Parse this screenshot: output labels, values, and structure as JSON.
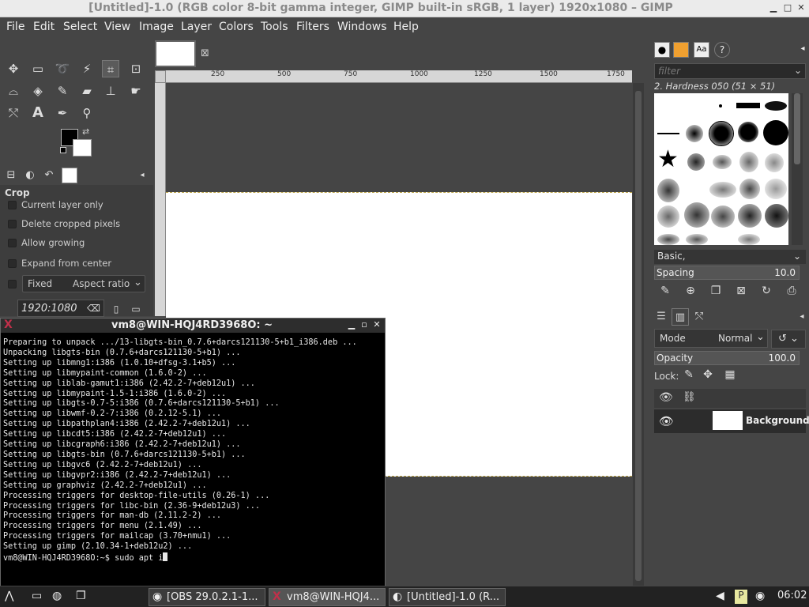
{
  "window": {
    "title": "[Untitled]-1.0 (RGB color 8-bit gamma integer, GIMP built-in sRGB, 1 layer) 1920x1080 – GIMP"
  },
  "menubar": [
    "File",
    "Edit",
    "Select",
    "View",
    "Image",
    "Layer",
    "Colors",
    "Tools",
    "Filters",
    "Windows",
    "Help"
  ],
  "tool_options": {
    "title": "Crop",
    "options": [
      "Current layer only",
      "Delete cropped pixels",
      "Allow growing",
      "Expand from center"
    ],
    "fixed_label": "Fixed",
    "fixed_mode": "Aspect ratio",
    "ratio_value": "1920:1080"
  },
  "ruler": {
    "h_ticks": [
      "250",
      "500",
      "750",
      "1000",
      "1250",
      "1500",
      "1750"
    ]
  },
  "brushes": {
    "filter_placeholder": "filter",
    "selected_name": "2. Hardness 050 (51 × 51)",
    "preset": "Basic,",
    "spacing_label": "Spacing",
    "spacing_value": "10.0"
  },
  "layers": {
    "mode_label": "Mode",
    "mode_value": "Normal",
    "opacity_label": "Opacity",
    "opacity_value": "100.0",
    "lock_label": "Lock:",
    "items": [
      {
        "name": "Background"
      }
    ]
  },
  "terminal": {
    "title": "vm8@WIN-HQJ4RD3968O: ~",
    "lines": [
      "Preparing to unpack .../13-libgts-bin_0.7.6+darcs121130-5+b1_i386.deb ...",
      "Unpacking libgts-bin (0.7.6+darcs121130-5+b1) ...",
      "Setting up libmng1:i386 (1.0.10+dfsg-3.1+b5) ...",
      "Setting up libmypaint-common (1.6.0-2) ...",
      "Setting up liblab-gamut1:i386 (2.42.2-7+deb12u1) ...",
      "Setting up libmypaint-1.5-1:i386 (1.6.0-2) ...",
      "Setting up libgts-0.7-5:i386 (0.7.6+darcs121130-5+b1) ...",
      "Setting up libwmf-0.2-7:i386 (0.2.12-5.1) ...",
      "Setting up libpathplan4:i386 (2.42.2-7+deb12u1) ...",
      "Setting up libcdt5:i386 (2.42.2-7+deb12u1) ...",
      "Setting up libcgraph6:i386 (2.42.2-7+deb12u1) ...",
      "Setting up libgts-bin (0.7.6+darcs121130-5+b1) ...",
      "Setting up libgvc6 (2.42.2-7+deb12u1) ...",
      "Setting up libgvpr2:i386 (2.42.2-7+deb12u1) ...",
      "Setting up graphviz (2.42.2-7+deb12u1) ...",
      "Processing triggers for desktop-file-utils (0.26-1) ...",
      "Processing triggers for libc-bin (2.36-9+deb12u3) ...",
      "Processing triggers for man-db (2.11.2-2) ...",
      "Processing triggers for menu (2.1.49) ...",
      "Processing triggers for mailcap (3.70+nmu1) ...",
      "Setting up gimp (2.10.34-1+deb12u2) ..."
    ],
    "prompt": "vm8@WIN-HQJ4RD3968O:~$ sudo apt i"
  },
  "taskbar": {
    "tasks": [
      "[OBS 29.0.2.1-1...",
      "vm8@WIN-HQJ4...",
      "[Untitled]-1.0 (R..."
    ],
    "clock": "06:02"
  }
}
